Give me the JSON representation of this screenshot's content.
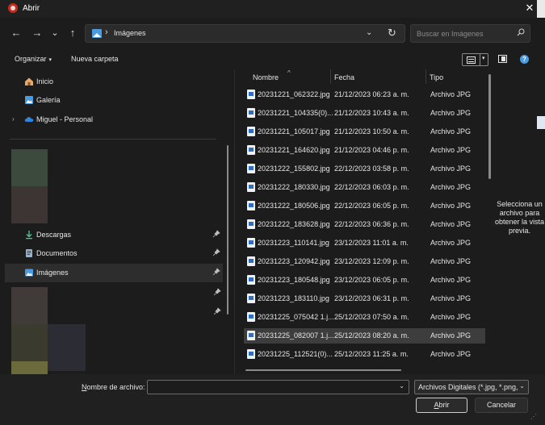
{
  "window": {
    "title": "Abrir",
    "close_glyph": "✕"
  },
  "address": {
    "separator": "›",
    "location": "Imágenes",
    "dropdown_glyph": "⌄",
    "refresh_glyph": "↻"
  },
  "nav": {
    "back_glyph": "←",
    "forward_glyph": "→",
    "recent_glyph": "⌄",
    "up_glyph": "↑"
  },
  "search": {
    "placeholder": "Buscar en Imágenes"
  },
  "toolbar": {
    "organize_label": "Organizar",
    "new_folder_label": "Nueva carpeta",
    "caret": "▾",
    "help_glyph": "?"
  },
  "sidebar": {
    "items": [
      {
        "label": "Inicio",
        "icon": "home-icon"
      },
      {
        "label": "Galería",
        "icon": "gallery-icon"
      },
      {
        "label": "Miguel - Personal",
        "icon": "onedrive-cloud-icon",
        "expander": "›"
      },
      {
        "label": "Descargas",
        "icon": "download-icon",
        "pinned": true
      },
      {
        "label": "Documentos",
        "icon": "documents-icon",
        "pinned": true
      },
      {
        "label": "Imágenes",
        "icon": "pictures-icon",
        "pinned": true,
        "selected": true
      }
    ]
  },
  "files": {
    "sort_glyph": "^",
    "columns": {
      "name": "Nombre",
      "date": "Fecha",
      "type": "Tipo"
    },
    "rows": [
      {
        "name": "20231221_062322.jpg",
        "date": "21/12/2023 06:23 a. m.",
        "type": "Archivo JPG"
      },
      {
        "name": "20231221_104335(0)...",
        "date": "21/12/2023 10:43 a. m.",
        "type": "Archivo JPG"
      },
      {
        "name": "20231221_105017.jpg",
        "date": "21/12/2023 10:50 a. m.",
        "type": "Archivo JPG"
      },
      {
        "name": "20231221_164620.jpg",
        "date": "21/12/2023 04:46 p. m.",
        "type": "Archivo JPG"
      },
      {
        "name": "20231222_155802.jpg",
        "date": "22/12/2023 03:58 p. m.",
        "type": "Archivo JPG"
      },
      {
        "name": "20231222_180330.jpg",
        "date": "22/12/2023 06:03 p. m.",
        "type": "Archivo JPG"
      },
      {
        "name": "20231222_180506.jpg",
        "date": "22/12/2023 06:05 p. m.",
        "type": "Archivo JPG"
      },
      {
        "name": "20231222_183628.jpg",
        "date": "22/12/2023 06:36 p. m.",
        "type": "Archivo JPG"
      },
      {
        "name": "20231223_110141.jpg",
        "date": "23/12/2023 11:01 a. m.",
        "type": "Archivo JPG"
      },
      {
        "name": "20231223_120942.jpg",
        "date": "23/12/2023 12:09 p. m.",
        "type": "Archivo JPG"
      },
      {
        "name": "20231223_180548.jpg",
        "date": "23/12/2023 06:05 p. m.",
        "type": "Archivo JPG"
      },
      {
        "name": "20231223_183110.jpg",
        "date": "23/12/2023 06:31 p. m.",
        "type": "Archivo JPG"
      },
      {
        "name": "20231225_075042 1.j...",
        "date": "25/12/2023 07:50 a. m.",
        "type": "Archivo JPG"
      },
      {
        "name": "20231225_082007 1.j...",
        "date": "25/12/2023 08:20 a. m.",
        "type": "Archivo JPG",
        "selected": true
      },
      {
        "name": "20231225_112521(0)...",
        "date": "25/12/2023 11:25 a. m.",
        "type": "Archivo JPG"
      }
    ]
  },
  "preview": {
    "message": "Selecciona un archivo para obtener la vista previa."
  },
  "bottom": {
    "filename_label_accel": "N",
    "filename_label_rest": "ombre de archivo:",
    "filename_value": "",
    "filter_value": "Archivos Digitales (*.jpg, *.png,",
    "open_accel": "A",
    "open_rest": "brir",
    "cancel_label": "Cancelar",
    "dropdown_glyph": "⌄"
  },
  "colors": {
    "accent": "#4a9be0",
    "background": "#1c1c1c",
    "selection": "#3d3d3d"
  }
}
